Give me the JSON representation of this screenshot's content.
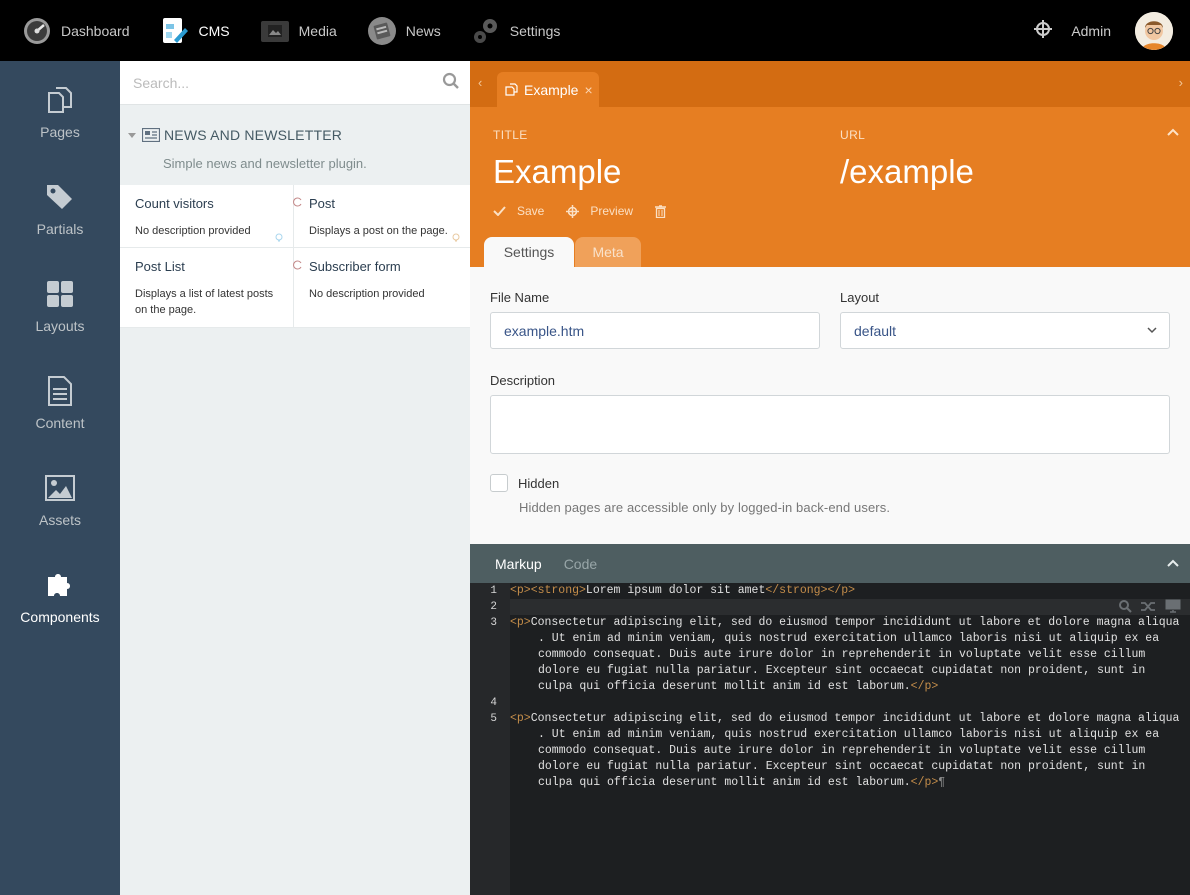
{
  "topnav": {
    "items": [
      {
        "label": "Dashboard",
        "icon": "speedometer-icon"
      },
      {
        "label": "CMS",
        "icon": "cms-icon"
      },
      {
        "label": "Media",
        "icon": "media-icon"
      },
      {
        "label": "News",
        "icon": "news-icon"
      },
      {
        "label": "Settings",
        "icon": "gears-icon"
      }
    ],
    "active": "CMS",
    "user_label": "Admin"
  },
  "sidebar": {
    "items": [
      {
        "label": "Pages",
        "icon": "pages-icon"
      },
      {
        "label": "Partials",
        "icon": "tags-icon"
      },
      {
        "label": "Layouts",
        "icon": "layouts-icon"
      },
      {
        "label": "Content",
        "icon": "content-file-icon"
      },
      {
        "label": "Assets",
        "icon": "image-icon"
      },
      {
        "label": "Components",
        "icon": "puzzle-icon"
      }
    ],
    "active": "Components"
  },
  "components_panel": {
    "search_placeholder": "Search...",
    "group": {
      "title": "NEWS AND NEWSLETTER",
      "description": "Simple news and newsletter plugin."
    },
    "components": [
      {
        "title": "Count visitors",
        "description": "No description provided"
      },
      {
        "title": "Post",
        "description": "Displays a post on the page."
      },
      {
        "title": "Post List",
        "description": "Displays a list of latest posts on the page."
      },
      {
        "title": "Subscriber form",
        "description": "No description provided"
      }
    ]
  },
  "editor": {
    "open_tab": {
      "label": "Example"
    },
    "title_label": "TITLE",
    "title_value": "Example",
    "url_label": "URL",
    "url_value": "/example",
    "toolbar": {
      "save_label": "Save",
      "preview_label": "Preview"
    },
    "sub_tabs": [
      "Settings",
      "Meta"
    ],
    "form": {
      "file_name_label": "File Name",
      "file_name_value": "example.htm",
      "layout_label": "Layout",
      "layout_value": "default",
      "description_label": "Description",
      "description_value": "",
      "hidden_label": "Hidden",
      "hidden_checked": false,
      "hidden_help": "Hidden pages are accessible only by logged-in back-end users."
    },
    "code_tabs": [
      "Markup",
      "Code"
    ],
    "code": {
      "line_numbers": [
        "1",
        "2",
        "3",
        "4",
        "5"
      ],
      "line1_open": "<p><strong>",
      "line1_text": "Lorem ipsum dolor sit amet",
      "line1_close": "</strong></p>",
      "para_open": "<p>",
      "para_close": "</p>",
      "para_rows": [
        "Consectetur adipiscing elit, sed do eiusmod tempor incididunt ut labore et dolore magna aliqua",
        ". Ut enim ad minim veniam, quis nostrud exercitation ullamco laboris nisi ut aliquip ex ea",
        "commodo consequat. Duis aute irure dolor in reprehenderit in voluptate velit esse cillum",
        "dolore eu fugiat nulla pariatur. Excepteur sint occaecat cupidatat non proident, sunt in",
        "culpa qui officia deserunt mollit anim id est laborum."
      ]
    }
  },
  "colors": {
    "topbar": "#000000",
    "sidebar": "#34495e",
    "accent_orange": "#e67e22",
    "tabbar_orange": "#d36c12",
    "code_bg": "#1d1f21"
  }
}
